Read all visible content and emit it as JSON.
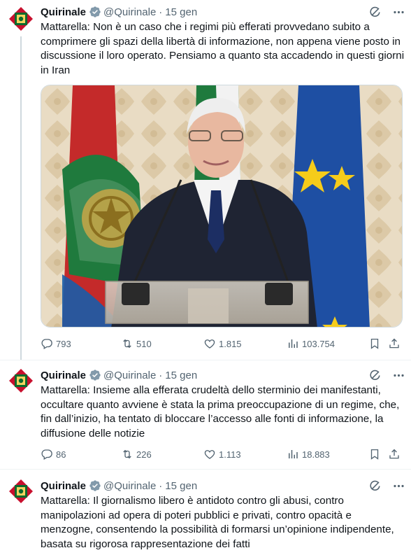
{
  "account": {
    "name": "Quirinale",
    "handle": "@Quirinale"
  },
  "colors": {
    "brand_blue": "#1d9bf0",
    "text": "#0f1419",
    "secondary": "#536471",
    "border": "#eff3f4"
  },
  "icons": {
    "verified": "verified-badge-icon",
    "grok": "grok-icon",
    "more": "more-icon",
    "reply": "reply-icon",
    "retweet": "retweet-icon",
    "like": "like-icon",
    "views": "views-icon",
    "bookmark": "bookmark-icon",
    "share": "share-icon"
  },
  "tweets": [
    {
      "date": "15 gen",
      "text": "Mattarella: Non è un caso che i regimi più efferati provvedano subito a comprimere gli spazi della libertà di informazione, non appena viene posto in discussione il loro operato. Pensiamo a quanto sta accadendo in questi giorni in Iran",
      "has_media": true,
      "stats": {
        "replies": "793",
        "retweets": "510",
        "likes": "1.815",
        "views": "103.754"
      }
    },
    {
      "date": "15 gen",
      "text": "Mattarella: Insieme alla efferata crudeltà dello sterminio dei manifestanti, occultare quanto avviene è stata la prima preoccupazione di un regime, che, fin dall’inizio, ha tentato di bloccare l’accesso alle fonti di informazione, la diffusione delle notizie",
      "has_media": false,
      "stats": {
        "replies": "86",
        "retweets": "226",
        "likes": "1.113",
        "views": "18.883"
      }
    },
    {
      "date": "15 gen",
      "text": "Mattarella: Il giornalismo libero è antidoto contro gli abusi, contro manipolazioni ad opera di poteri pubblici e privati, contro opacità e menzogne, consentendo la possibilità di formarsi un’opinione indipendente, basata su rigorosa rappresentazione dei fatti",
      "has_media": false
    }
  ],
  "dot": "·"
}
